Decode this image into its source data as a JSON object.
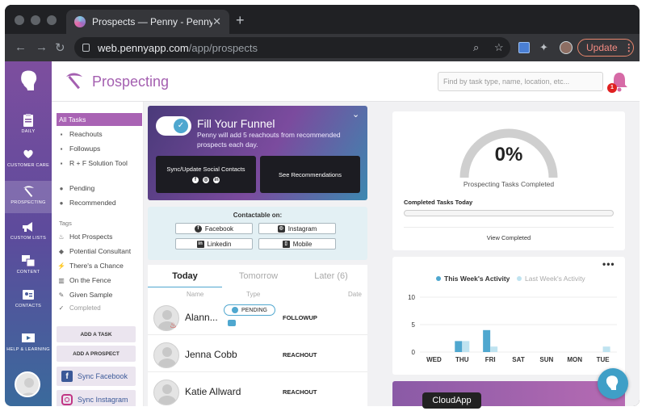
{
  "browser": {
    "tab_title": "Prospects — Penny - Penny",
    "tab_close": "✕",
    "new_tab": "+",
    "url_host": "web.pennyapp.com",
    "url_path": "/app/prospects",
    "update_label": "Update",
    "update_kebab": "⋮"
  },
  "rail": {
    "items": [
      {
        "label": "DAILY"
      },
      {
        "label": "CUSTOMER CARE"
      },
      {
        "label": "PROSPECTING"
      },
      {
        "label": "CUSTOM LISTS"
      },
      {
        "label": "CONTENT"
      },
      {
        "label": "CONTACTS"
      },
      {
        "label": "HELP & LEARNING"
      }
    ]
  },
  "header": {
    "title": "Prospecting",
    "search_placeholder": "Find by task type, name, location, etc...",
    "notification_count": "1"
  },
  "filters": {
    "main": [
      {
        "label": "All Tasks",
        "icon": ""
      },
      {
        "label": "Reachouts",
        "icon": "▪"
      },
      {
        "label": "Followups",
        "icon": "▪"
      },
      {
        "label": "R + F Solution Tool",
        "icon": "▪"
      },
      {
        "label": "Pending",
        "icon": "●"
      },
      {
        "label": "Recommended",
        "icon": "●"
      }
    ],
    "tags_title": "Tags",
    "tags": [
      {
        "label": "Hot Prospects",
        "icon": "♨"
      },
      {
        "label": "Potential Consultant",
        "icon": "◆"
      },
      {
        "label": "There's a Chance",
        "icon": "⚡"
      },
      {
        "label": "On the Fence",
        "icon": "▥"
      },
      {
        "label": "Given Sample",
        "icon": "✎"
      },
      {
        "label": "Completed",
        "icon": "✓"
      }
    ],
    "add_task": "ADD A TASK",
    "add_prospect": "ADD A PROSPECT",
    "sync_facebook": "Sync Facebook",
    "sync_instagram": "Sync Instagram"
  },
  "funnel": {
    "title": "Fill Your Funnel",
    "subtitle": "Penny will add 5 reachouts from recommended prospects each day.",
    "sync_label": "Sync/Update Social Contacts",
    "see_label": "See Recommendations"
  },
  "contactable": {
    "title": "Contactable on:",
    "facebook": "Facebook",
    "instagram": "Instagram",
    "linkedin": "Linkedin",
    "mobile": "Mobile"
  },
  "tabs": [
    {
      "label": "Today"
    },
    {
      "label": "Tomorrow"
    },
    {
      "label": "Later (6)"
    }
  ],
  "list": {
    "columns": {
      "name": "Name",
      "type": "Type",
      "date": "Date"
    },
    "rows": [
      {
        "name": "Alann...",
        "badge": "PENDING",
        "type": "FOLLOWUP"
      },
      {
        "name": "Jenna Cobb",
        "type": "REACHOUT"
      },
      {
        "name": "Katie Allward",
        "type": "REACHOUT"
      }
    ]
  },
  "progress": {
    "percent_label": "0%",
    "percent_value": 0,
    "subtitle": "Prospecting Tasks Completed",
    "completed_today_label": "Completed Tasks Today",
    "completed_today_fraction": 0,
    "view_completed": "View Completed"
  },
  "activity": {
    "legend_this": "This Week's Activity",
    "legend_last": "Last Week's Activity",
    "color_this": "#4fa7cf",
    "color_last": "#bfe3f0"
  },
  "chart_data": {
    "type": "bar",
    "categories": [
      "WED",
      "THU",
      "FRI",
      "SAT",
      "SUN",
      "MON",
      "TUE"
    ],
    "series": [
      {
        "name": "This Week's Activity",
        "values": [
          0,
          2,
          4,
          0,
          0,
          0,
          0
        ]
      },
      {
        "name": "Last Week's Activity",
        "values": [
          0,
          2,
          1,
          0,
          0,
          0,
          1
        ]
      }
    ],
    "yticks": [
      "10",
      "5",
      "0"
    ],
    "ylim": [
      0,
      10
    ],
    "legend": "top"
  },
  "tooltip": "CloudApp"
}
